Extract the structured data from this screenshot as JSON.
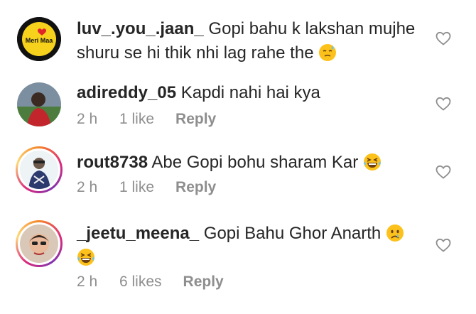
{
  "comments": [
    {
      "username": "luv_.you_.jaan_",
      "text": "Gopi bahu k lakshan mujhe shuru se hi thik nhi lag rahe the",
      "emoji_icon": "downcast-face-with-sweat-icon",
      "avatar_icon": "meri-maa-logo-avatar",
      "avatar_text": "Meri Maa"
    },
    {
      "username": "adireddy_05",
      "text": "Kapdi nahi hai kya",
      "time": "2 h",
      "likes": "1 like",
      "reply": "Reply",
      "avatar_icon": "user-photo-avatar"
    },
    {
      "username": "rout8738",
      "text": "Abe Gopi bohu sharam Kar",
      "emoji_icon": "grinning-squinting-face-icon",
      "time": "2 h",
      "likes": "1 like",
      "reply": "Reply",
      "avatar_icon": "user-photo-avatar"
    },
    {
      "username": "_jeetu_meena_",
      "text": "Gopi Bahu Ghor Anarth",
      "emoji_icon": "sad-face-icon",
      "emoji2_icon": "grinning-squinting-face-icon",
      "time": "2 h",
      "likes": "6 likes",
      "reply": "Reply",
      "avatar_icon": "user-photo-avatar"
    }
  ]
}
